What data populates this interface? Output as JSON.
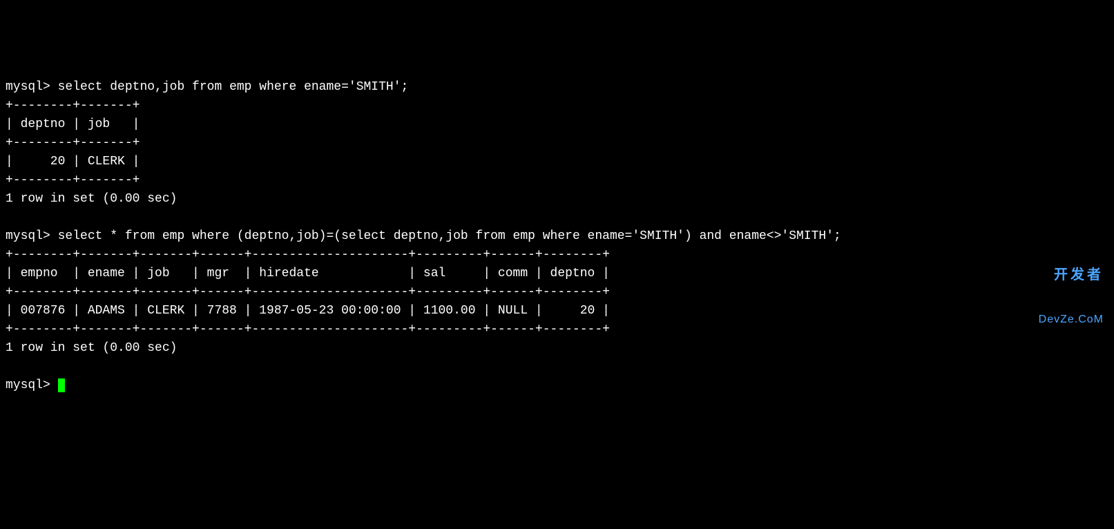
{
  "terminal": {
    "prompt": "mysql> ",
    "query1": "select deptno,job from emp where ename='SMITH';",
    "table1_border": "+--------+-------+",
    "table1_header": "| deptno | job   |",
    "table1_row1": "|     20 | CLERK |",
    "result1_status": "1 row in set (0.00 sec)",
    "query2": "select * from emp where (deptno,job)=(select deptno,job from emp where ename='SMITH') and ename<>'SMITH';",
    "table2_border": "+--------+-------+-------+------+---------------------+---------+------+--------+",
    "table2_header": "| empno  | ename | job   | mgr  | hiredate            | sal     | comm | deptno |",
    "table2_row1": "| 007876 | ADAMS | CLERK | 7788 | 1987-05-23 00:00:00 | 1100.00 | NULL |     20 |",
    "result2_status": "1 row in set (0.00 sec)"
  },
  "chart_data": {
    "type": "table",
    "tables": [
      {
        "columns": [
          "deptno",
          "job"
        ],
        "rows": [
          {
            "deptno": 20,
            "job": "CLERK"
          }
        ]
      },
      {
        "columns": [
          "empno",
          "ename",
          "job",
          "mgr",
          "hiredate",
          "sal",
          "comm",
          "deptno"
        ],
        "rows": [
          {
            "empno": "007876",
            "ename": "ADAMS",
            "job": "CLERK",
            "mgr": 7788,
            "hiredate": "1987-05-23 00:00:00",
            "sal": 1100.0,
            "comm": null,
            "deptno": 20
          }
        ]
      }
    ]
  },
  "watermark": {
    "line1": "开发者",
    "line2": "DevZe.CoM"
  }
}
